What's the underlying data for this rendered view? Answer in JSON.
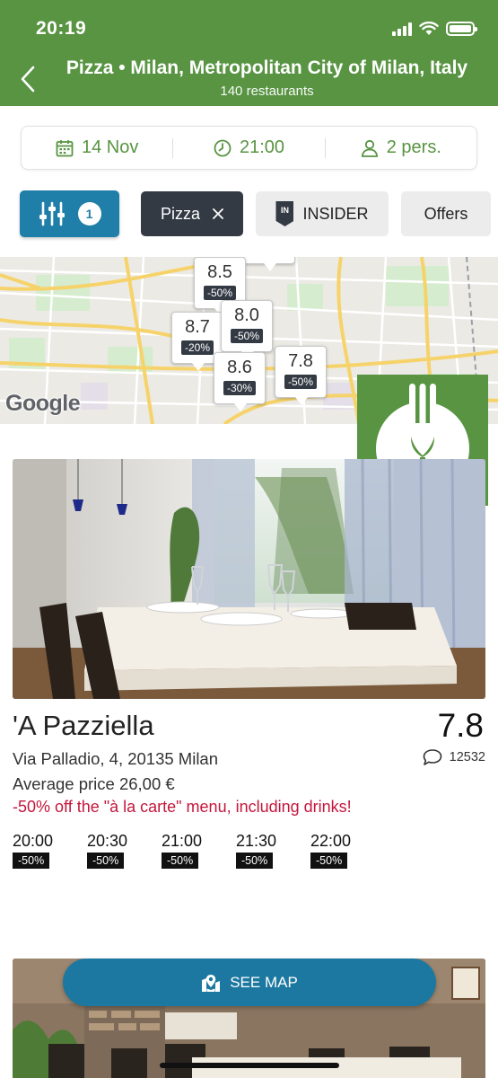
{
  "status": {
    "time": "20:19"
  },
  "header": {
    "title": "Pizza • Milan, Metropolitan City of Milan, Italy",
    "subtitle": "140 restaurants"
  },
  "booking": {
    "date": "14 Nov",
    "time": "21:00",
    "party": "2 pers."
  },
  "filters": {
    "count": "1",
    "pizza_label": "Pizza",
    "insider_badge": "IN",
    "insider_label": "INSIDER",
    "offers_label": "Offers"
  },
  "map": {
    "attribution": "Google",
    "pins": [
      {
        "score": "8.5",
        "discount": "-50%"
      },
      {
        "score": "8.7",
        "discount": "-20%"
      },
      {
        "score": "8.0",
        "discount": "-50%"
      },
      {
        "score": "8.6",
        "discount": "-30%"
      },
      {
        "score": "7.8",
        "discount": "-50%"
      }
    ]
  },
  "restaurant": {
    "name": "'A Pazziella",
    "score": "7.8",
    "address": "Via Palladio, 4, 20135 Milan",
    "reviews": "12532",
    "price": "Average price 26,00 €",
    "offer": "-50% off the \"à la carte\" menu, including drinks!",
    "slots": [
      {
        "time": "20:00",
        "discount": "-50%"
      },
      {
        "time": "20:30",
        "discount": "-50%"
      },
      {
        "time": "21:00",
        "discount": "-50%"
      },
      {
        "time": "21:30",
        "discount": "-50%"
      },
      {
        "time": "22:00",
        "discount": "-50%"
      }
    ]
  },
  "see_map": {
    "label": "SEE MAP"
  },
  "colors": {
    "brand_green": "#589442",
    "filter_blue": "#1f7fa8",
    "chip_dark": "#333a44",
    "offer_red": "#c4163c"
  },
  "icons": [
    "back-icon",
    "calendar-icon",
    "clock-icon",
    "person-icon",
    "filter-sliders-icon",
    "close-icon",
    "insider-icon",
    "speech-bubble-icon",
    "map-pin-icon",
    "fork-logo-icon"
  ]
}
